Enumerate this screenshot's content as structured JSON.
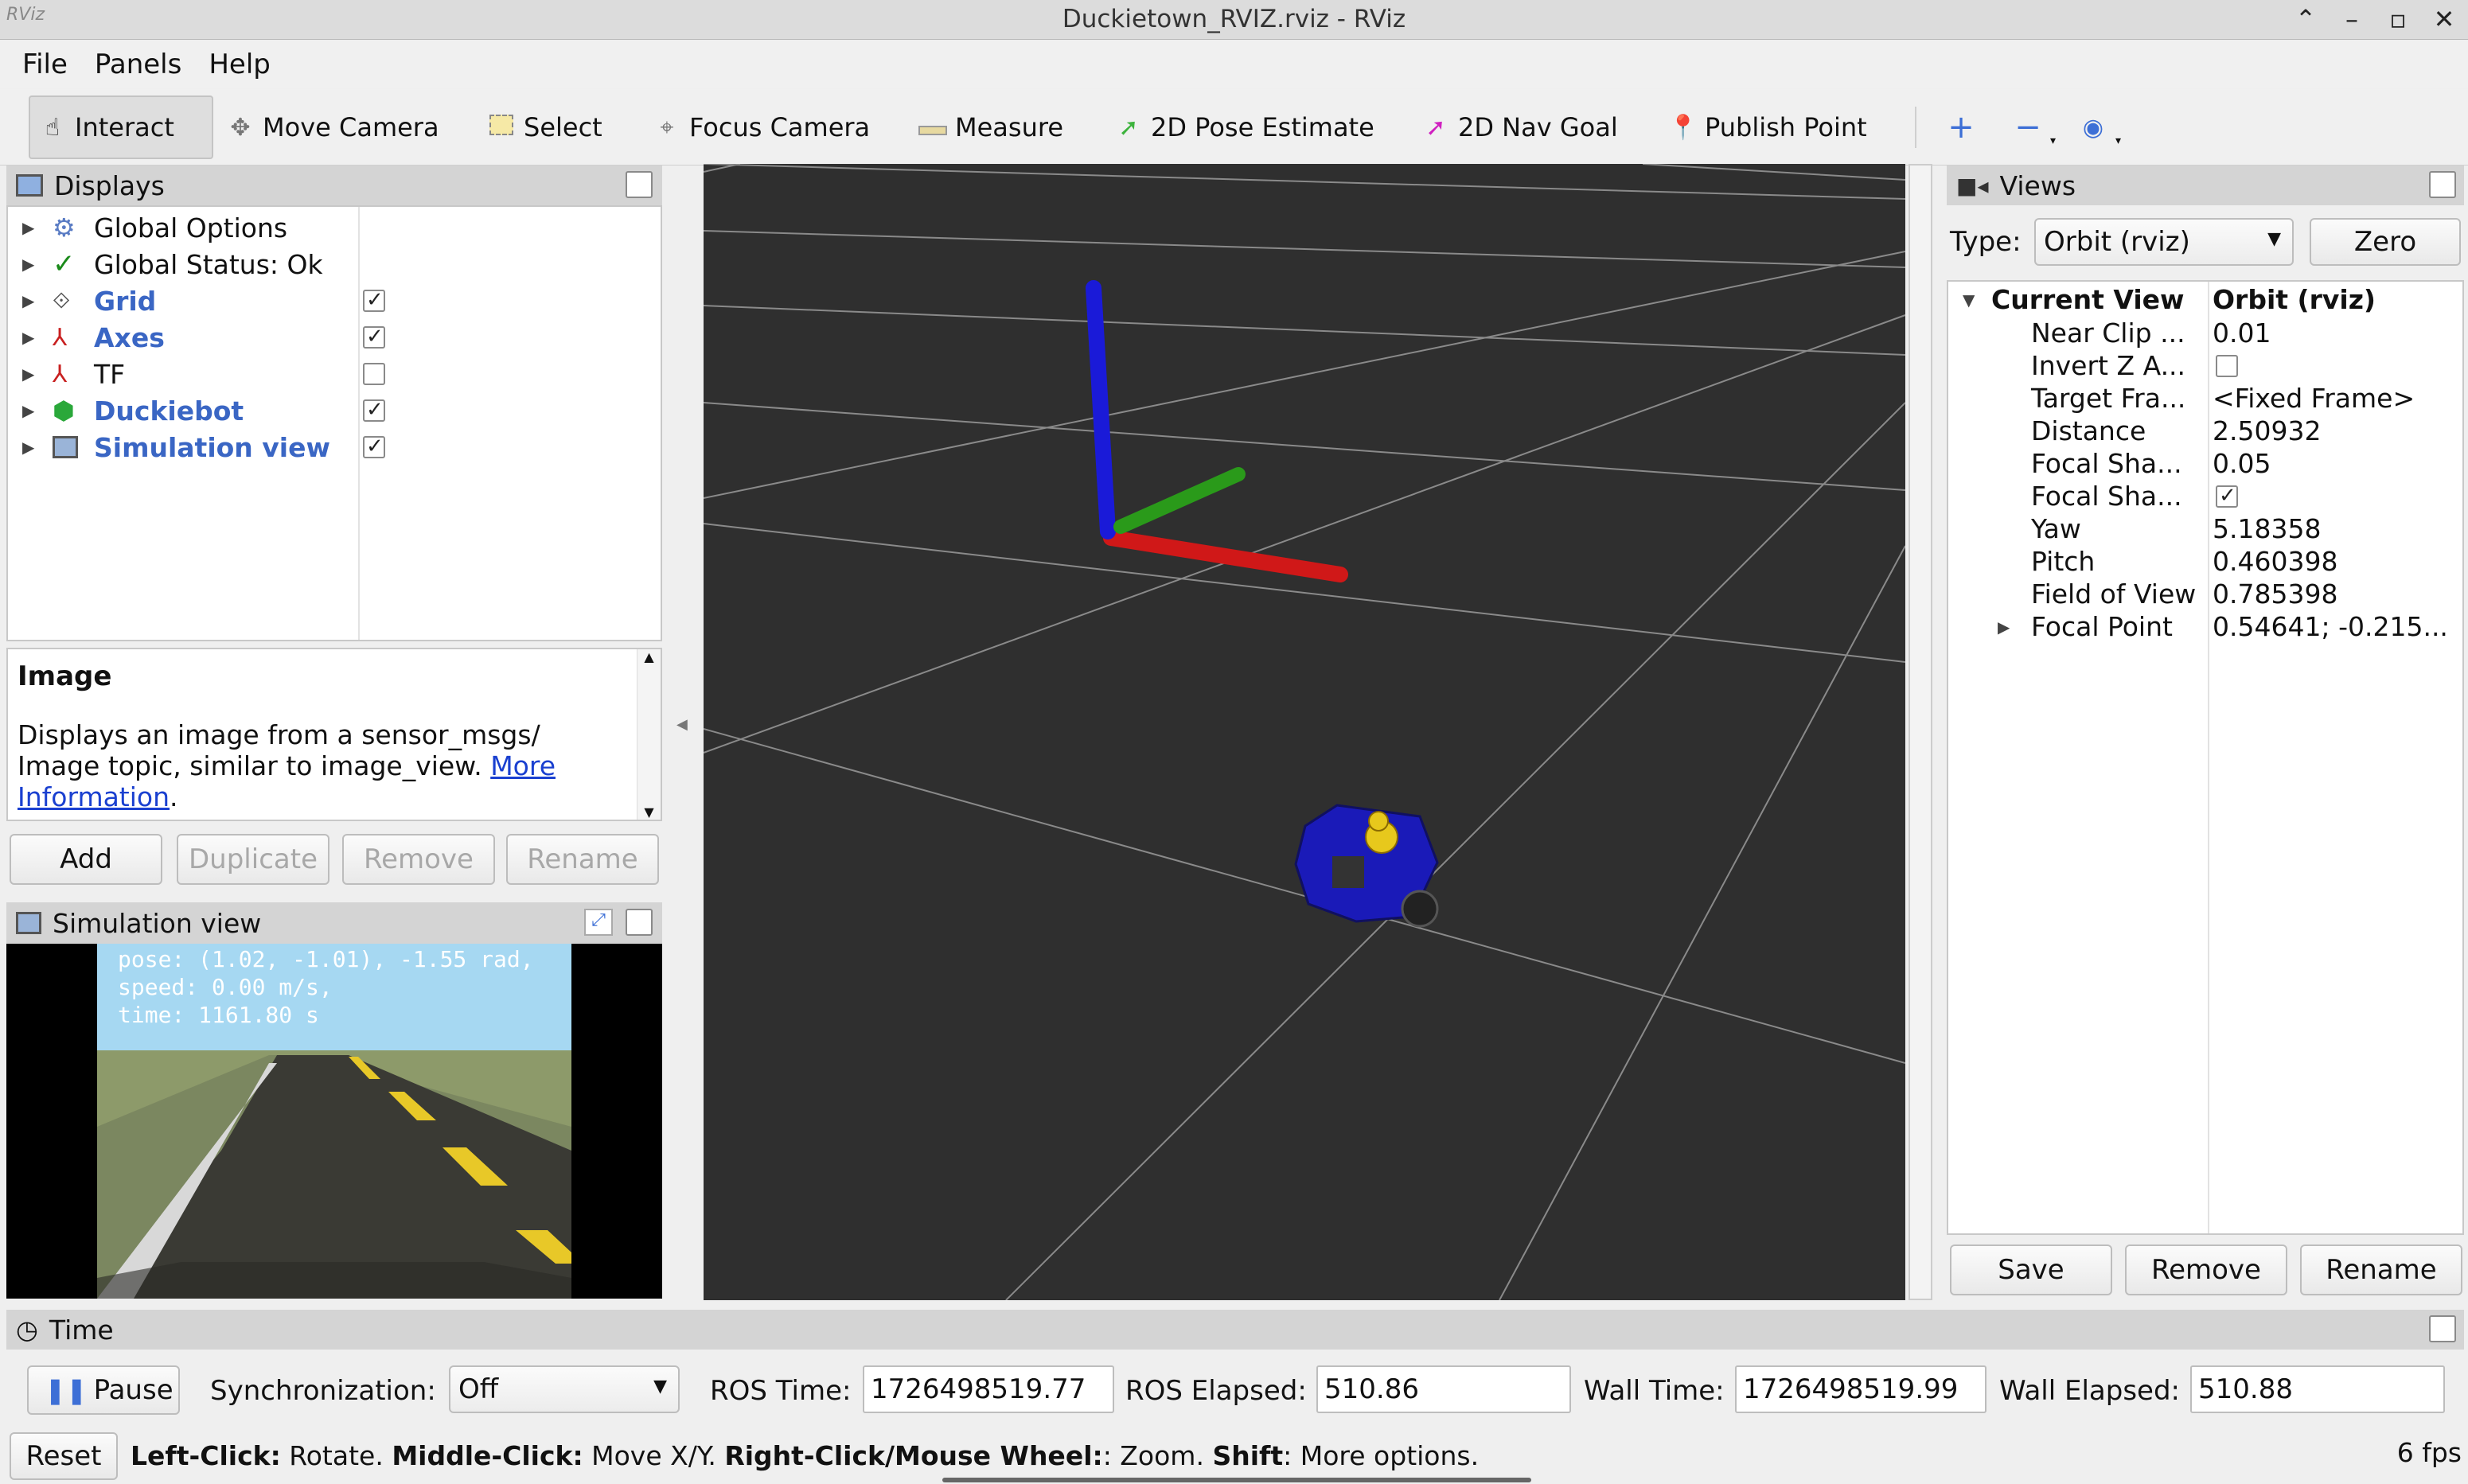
{
  "window": {
    "title": "Duckietown_RVIZ.rviz - RViz",
    "logo": "RViz"
  },
  "menu": [
    "File",
    "Panels",
    "Help"
  ],
  "toolbar": {
    "tools": [
      {
        "label": "Interact",
        "icon": "hand-icon"
      },
      {
        "label": "Move Camera",
        "icon": "move-camera-icon"
      },
      {
        "label": "Select",
        "icon": "select-icon"
      },
      {
        "label": "Focus Camera",
        "icon": "focus-camera-icon"
      },
      {
        "label": "Measure",
        "icon": "ruler-icon"
      },
      {
        "label": "2D Pose Estimate",
        "icon": "pose-arrow-icon"
      },
      {
        "label": "2D Nav Goal",
        "icon": "nav-goal-arrow-icon"
      },
      {
        "label": "Publish Point",
        "icon": "pin-icon"
      }
    ],
    "active": "Interact"
  },
  "displays": {
    "title": "Displays",
    "items": [
      {
        "label": "Global Options",
        "enabled": null,
        "highlight": false
      },
      {
        "label": "Global Status: Ok",
        "enabled": null,
        "highlight": false
      },
      {
        "label": "Grid",
        "enabled": true,
        "highlight": true
      },
      {
        "label": "Axes",
        "enabled": true,
        "highlight": true
      },
      {
        "label": "TF",
        "enabled": false,
        "highlight": false
      },
      {
        "label": "Duckiebot",
        "enabled": true,
        "highlight": true
      },
      {
        "label": "Simulation view",
        "enabled": true,
        "highlight": true
      }
    ],
    "help": {
      "title": "Image",
      "text": "Displays an image from a sensor_msgs/ Image topic, similar to image_view.",
      "link": "More Information",
      "link_tail": "."
    },
    "buttons": {
      "add": "Add",
      "duplicate": "Duplicate",
      "remove": "Remove",
      "rename": "Rename"
    }
  },
  "simulation_view": {
    "title": "Simulation view",
    "overlay": [
      "pose: (1.02, -1.01), -1.55 rad,",
      "speed: 0.00 m/s,",
      "time: 1161.80 s"
    ]
  },
  "views": {
    "title": "Views",
    "type_label": "Type:",
    "type_value": "Orbit (rviz)",
    "zero_label": "Zero",
    "header": {
      "name": "Current View",
      "value": "Orbit (rviz)"
    },
    "properties": [
      {
        "name": "Near Clip ...",
        "value": "0.01"
      },
      {
        "name": "Invert Z A...",
        "value": "",
        "checkbox": false
      },
      {
        "name": "Target Fra...",
        "value": "<Fixed Frame>"
      },
      {
        "name": "Distance",
        "value": "2.50932"
      },
      {
        "name": "Focal Sha...",
        "value": "0.05"
      },
      {
        "name": "Focal Sha...",
        "value": "",
        "checkbox": true
      },
      {
        "name": "Yaw",
        "value": "5.18358"
      },
      {
        "name": "Pitch",
        "value": "0.460398"
      },
      {
        "name": "Field of View",
        "value": "0.785398"
      },
      {
        "name": "Focal Point",
        "value": "0.54641; -0.215..."
      }
    ],
    "buttons": {
      "save": "Save",
      "remove": "Remove",
      "rename": "Rename"
    }
  },
  "time": {
    "title": "Time",
    "pause_label": "Pause",
    "sync_label": "Synchronization:",
    "sync_value": "Off",
    "ros_time_label": "ROS Time:",
    "ros_time": "1726498519.77",
    "ros_elapsed_label": "ROS Elapsed:",
    "ros_elapsed": "510.86",
    "wall_time_label": "Wall Time:",
    "wall_time": "1726498519.99",
    "wall_elapsed_label": "Wall Elapsed:",
    "wall_elapsed": "510.88"
  },
  "status": {
    "reset_label": "Reset",
    "parts": [
      {
        "b": "Left-Click:",
        "t": " Rotate. "
      },
      {
        "b": "Middle-Click:",
        "t": " Move X/Y. "
      },
      {
        "b": "Right-Click/Mouse Wheel:",
        "t": ": Zoom. "
      },
      {
        "b": "Shift",
        "t": ": More options."
      }
    ],
    "fps": "6 fps"
  },
  "colors": {
    "axis_x": "#d01818",
    "axis_y": "#2a9a1a",
    "axis_z": "#1a1ad8",
    "link": "#1a40d0",
    "highlight_text": "#3a66c4"
  }
}
